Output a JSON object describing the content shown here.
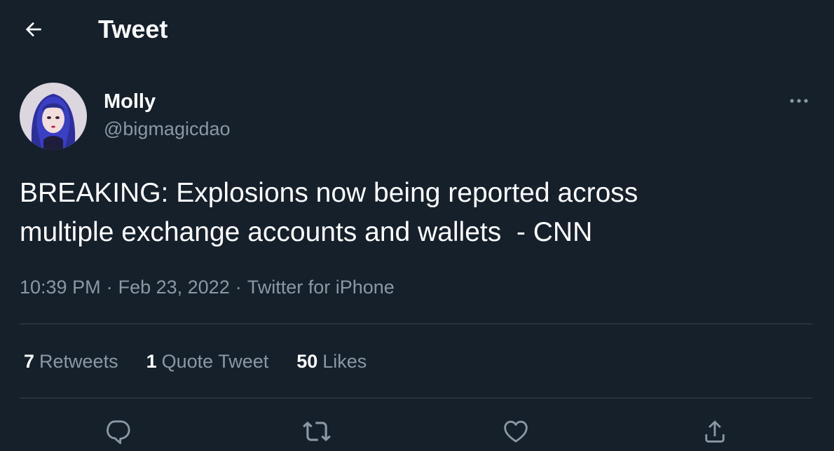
{
  "header": {
    "title": "Tweet",
    "back_icon": "arrow-left-icon"
  },
  "tweet": {
    "author": {
      "display_name": "Molly",
      "handle": "@bigmagicdao",
      "avatar": "avatar-illustration"
    },
    "more_icon": "more-horizontal-icon",
    "text": "BREAKING: Explosions now being reported across\nmultiple exchange accounts and wallets  - CNN",
    "time": "10:39 PM",
    "date": "Feb 23, 2022",
    "source": "Twitter for iPhone",
    "separator": "·"
  },
  "stats": {
    "retweets": {
      "count": "7",
      "label": "Retweets"
    },
    "quote_tweets": {
      "count": "1",
      "label": "Quote Tweet"
    },
    "likes": {
      "count": "50",
      "label": "Likes"
    }
  },
  "actions": {
    "reply_icon": "reply-icon",
    "retweet_icon": "retweet-icon",
    "like_icon": "heart-icon",
    "share_icon": "share-icon"
  },
  "colors": {
    "background": "#15202b",
    "primary_text": "#ffffff",
    "secondary_text": "#8b98a5",
    "divider": "#38444d"
  }
}
